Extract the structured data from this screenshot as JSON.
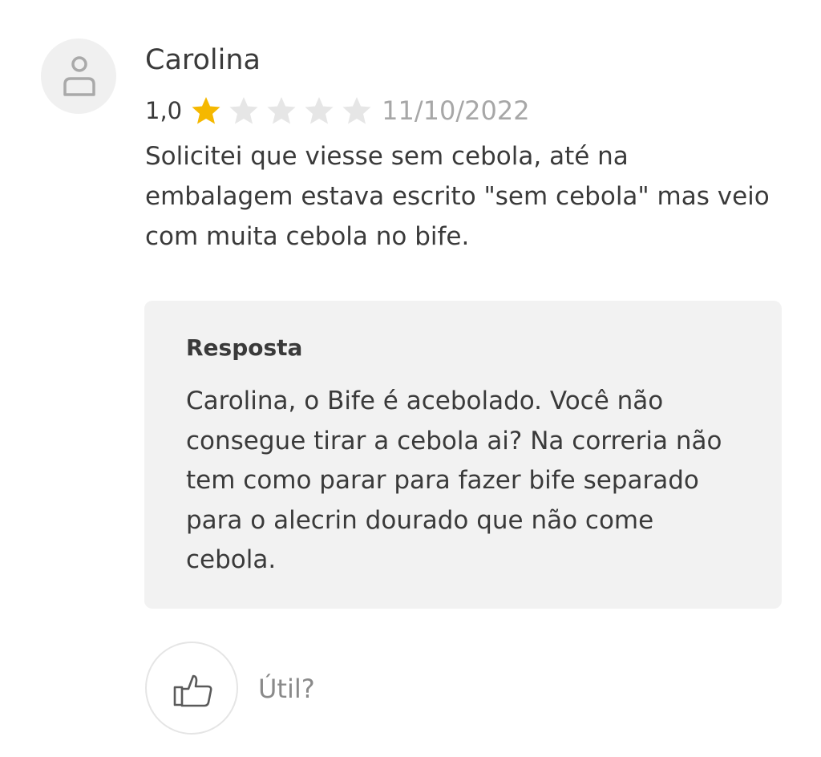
{
  "review": {
    "reviewer_name": "Carolina",
    "avatar_icon": "user-icon",
    "rating_text": "1,0",
    "rating": 1,
    "max_rating": 5,
    "date": "11/10/2022",
    "text": "Solicitei que viesse sem cebola, até na embalagem estava escrito \"sem cebola\" mas veio com muita cebola no bife."
  },
  "reply": {
    "title": "Resposta",
    "text": "Carolina, o Bife é acebolado. Você não consegue tirar a cebola ai? Na correria não tem como parar para fazer bife separado para o alecrin dourado que não come cebola."
  },
  "helpful": {
    "icon": "thumbs-up-icon",
    "label": "Útil?"
  },
  "colors": {
    "star_filled": "#F5B800",
    "star_empty": "#E6E6E6",
    "text": "#3A3A3A",
    "muted": "#A7A7A7",
    "reply_background": "#F2F2F2"
  }
}
